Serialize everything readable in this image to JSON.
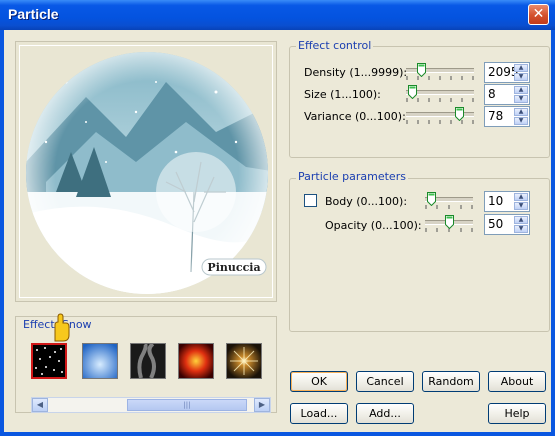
{
  "window": {
    "title": "Particle",
    "close_glyph": "✕"
  },
  "preview": {
    "watermark_text": "Pinuccia"
  },
  "effects": {
    "group_label": "Effect: Snow",
    "thumbnails": [
      {
        "name": "snow",
        "selected": true
      },
      {
        "name": "sky",
        "selected": false
      },
      {
        "name": "smoke",
        "selected": false
      },
      {
        "name": "fire",
        "selected": false
      },
      {
        "name": "sparkle",
        "selected": false
      }
    ],
    "scroll_left": "◀",
    "scroll_right": "▶",
    "scroll_grip": "|||"
  },
  "effect_control": {
    "label": "Effect control",
    "density": {
      "label": "Density (1...9999):",
      "value": "2095",
      "level": 0.21
    },
    "size": {
      "label": "Size (1...100):",
      "value": "8",
      "level": 0.07
    },
    "variance": {
      "label": "Variance (0...100):",
      "value": "78",
      "level": 0.78
    }
  },
  "particle_parameters": {
    "label": "Particle parameters",
    "body": {
      "label": "Body (0...100):",
      "value": "10",
      "level": 0.1,
      "checked": false
    },
    "opacity": {
      "label": "Opacity (0...100):",
      "value": "50",
      "level": 0.5
    }
  },
  "buttons": {
    "ok": "OK",
    "cancel": "Cancel",
    "random": "Random",
    "about": "About",
    "load": "Load...",
    "add": "Add...",
    "help": "Help"
  },
  "colors": {
    "title_bar": "#0a57e0",
    "group_label": "#1a3eb0",
    "selected_thumb": "#d01818"
  }
}
